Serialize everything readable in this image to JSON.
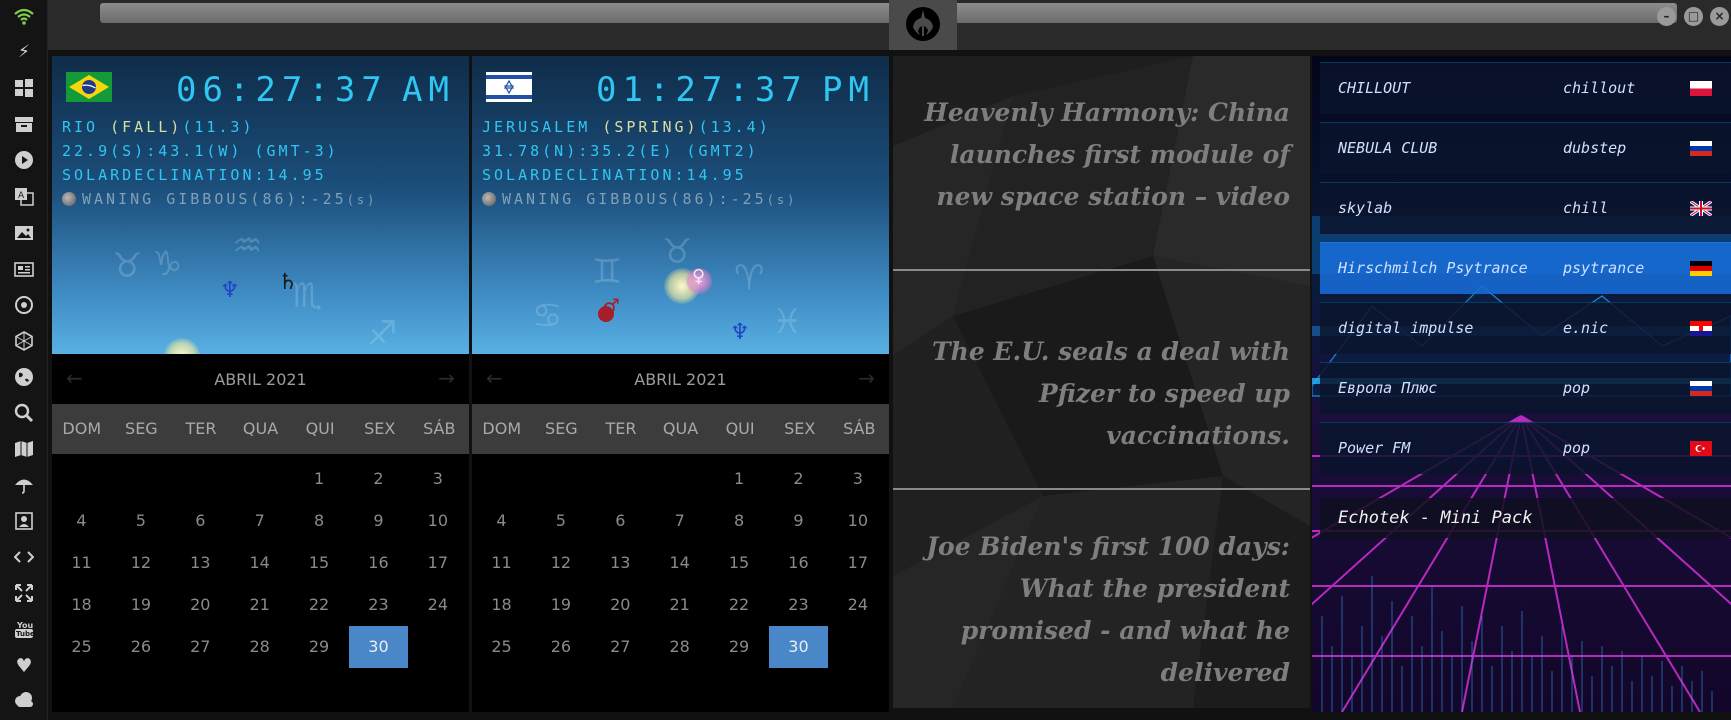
{
  "clocks": [
    {
      "time": "06:27:37",
      "ampm": "AM",
      "city_line_prefix": "RIO ",
      "season": "(FALL)",
      "city_line_suffix": "(11.3)",
      "coords_line": "22.9(S):43.1(W) (GMT-3)",
      "solar_line": "SOLARDECLINATION:14.95",
      "moon_line": "WANING GIBBOUS(86):-25",
      "moon_unit": "(s)"
    },
    {
      "time": "01:27:37",
      "ampm": "PM",
      "city_line_prefix": "JERUSALEM ",
      "season": "(SPRING)",
      "city_line_suffix": "(13.4)",
      "coords_line": "31.78(N):35.2(E) (GMT2)",
      "solar_line": "SOLARDECLINATION:14.95",
      "moon_line": "WANING GIBBOUS(86):-25",
      "moon_unit": "(s)"
    }
  ],
  "calendars": [
    {
      "title": "ABRIL 2021",
      "prev": "←",
      "next": "→",
      "weekdays": [
        "DOM",
        "SEG",
        "TER",
        "QUA",
        "QUI",
        "SEX",
        "SÁB"
      ],
      "weeks": [
        [
          "",
          "",
          "",
          "",
          "1",
          "2",
          "3"
        ],
        [
          "4",
          "5",
          "6",
          "7",
          "8",
          "9",
          "10"
        ],
        [
          "11",
          "12",
          "13",
          "14",
          "15",
          "16",
          "17"
        ],
        [
          "18",
          "19",
          "20",
          "21",
          "22",
          "23",
          "24"
        ],
        [
          "25",
          "26",
          "27",
          "28",
          "29",
          "30",
          ""
        ]
      ],
      "today": "30"
    },
    {
      "title": "ABRIL 2021",
      "prev": "←",
      "next": "→",
      "weekdays": [
        "DOM",
        "SEG",
        "TER",
        "QUA",
        "QUI",
        "SEX",
        "SÁB"
      ],
      "weeks": [
        [
          "",
          "",
          "",
          "",
          "1",
          "2",
          "3"
        ],
        [
          "4",
          "5",
          "6",
          "7",
          "8",
          "9",
          "10"
        ],
        [
          "11",
          "12",
          "13",
          "14",
          "15",
          "16",
          "17"
        ],
        [
          "18",
          "19",
          "20",
          "21",
          "22",
          "23",
          "24"
        ],
        [
          "25",
          "26",
          "27",
          "28",
          "29",
          "30",
          ""
        ]
      ],
      "today": "30"
    }
  ],
  "news": [
    "Heavenly Harmony: China launches first module of new space station – video",
    "The E.U. seals a deal with Pfizer to speed up vaccinations.",
    "Joe Biden's first 100 days: What the president promised - and what he delivered"
  ],
  "radio": {
    "stations": [
      {
        "name": "CHILLOUT",
        "genre": "chillout",
        "flag": "poland"
      },
      {
        "name": "NEBULA CLUB",
        "genre": "dubstep",
        "flag": "russia"
      },
      {
        "name": "skylab",
        "genre": "chill",
        "flag": "uk"
      },
      {
        "name": "Hirschmilch Psytrance",
        "genre": "psytrance",
        "flag": "germany"
      },
      {
        "name": "digital impulse",
        "genre": "e.nic",
        "flag": "croatia"
      },
      {
        "name": "Европа Плюс",
        "genre": "pop",
        "flag": "russia"
      },
      {
        "name": "Power FM",
        "genre": "pop",
        "flag": "turkey"
      }
    ],
    "selected_index": 3,
    "footer": "Echotek - Mini Pack"
  },
  "sidebar_icons": [
    "wifi-icon",
    "bolt-icon",
    "windows-icon",
    "archive-icon",
    "play-icon",
    "translate-icon",
    "image-icon",
    "news-icon",
    "settings-icon",
    "hexagon-icon",
    "globe-icon",
    "search-icon",
    "map-icon",
    "umbrella-icon",
    "contact-icon",
    "code-icon",
    "expand-icon",
    "youtube-icon",
    "heart-icon",
    "cloud-icon"
  ],
  "colors": {
    "clock_text": "#2fc6f2",
    "season_text": "#d7dfa6",
    "calendar_today": "#4a87c9",
    "radio_selected": "#1e6edc"
  }
}
